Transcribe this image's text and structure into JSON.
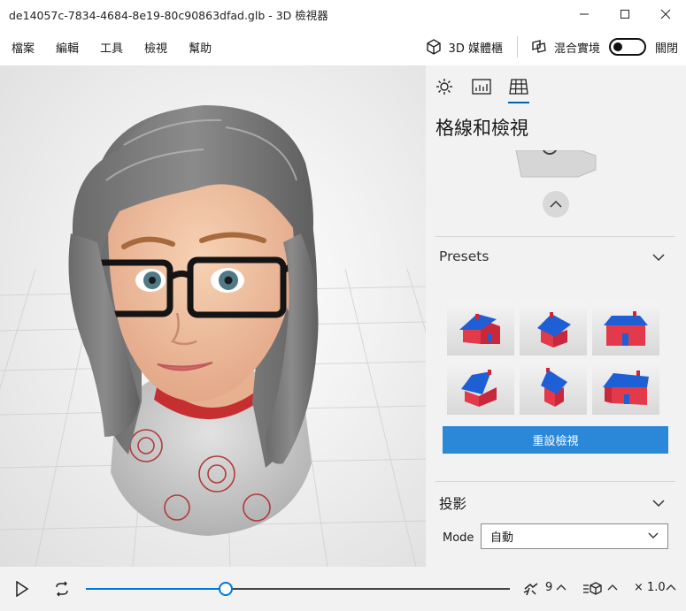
{
  "window": {
    "title": "de14057c-7834-4684-8e19-80c90863dfad.glb - 3D 檢視器",
    "controls": [
      "minimize-icon",
      "maximize-icon",
      "close-icon"
    ]
  },
  "menu": {
    "items": [
      "檔案",
      "編輯",
      "工具",
      "檢視",
      "幫助"
    ],
    "library_label": "3D 媒體櫃",
    "mixed_reality_label": "混合實境",
    "toggle_label": "關閉",
    "toggle_on": false
  },
  "panel": {
    "tabs": [
      {
        "icon": "sun-icon",
        "active": false
      },
      {
        "icon": "stats-icon",
        "active": false
      },
      {
        "icon": "grid-icon",
        "active": true
      }
    ],
    "title": "格線和檢視",
    "presets_label": "Presets",
    "presets": [
      "front-left-view",
      "top-front-view",
      "front-view",
      "top-left-view",
      "top-side-view",
      "front-right-view"
    ],
    "reset_button_label": "重設檢視",
    "projection_label": "投影",
    "mode_label": "Mode",
    "mode_value": "自動"
  },
  "colors": {
    "accent": "#0078d7",
    "reset_button": "#2b88d8",
    "house_wall": "#e23a4a",
    "house_roof": "#1f5fd6"
  },
  "bottom": {
    "slider_progress": 0.33,
    "frame_count": "9",
    "zoom_label": "× 1.0"
  }
}
